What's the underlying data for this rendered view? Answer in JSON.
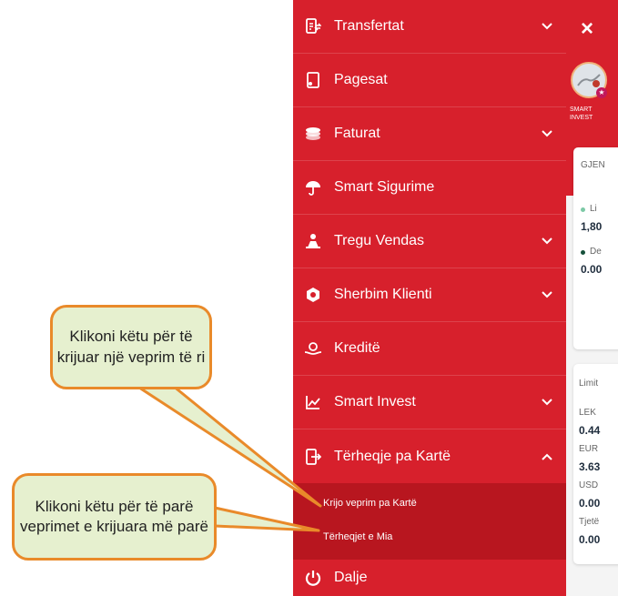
{
  "menu": {
    "items": [
      {
        "label": "Transfertat",
        "icon": "transfer-icon",
        "expandable": true
      },
      {
        "label": "Pagesat",
        "icon": "payment-icon",
        "expandable": false
      },
      {
        "label": "Faturat",
        "icon": "bills-icon",
        "expandable": true
      },
      {
        "label": "Smart Sigurime",
        "icon": "umbrella-icon",
        "expandable": false
      },
      {
        "label": "Tregu Vendas",
        "icon": "market-icon",
        "expandable": true
      },
      {
        "label": "Sherbim Klienti",
        "icon": "support-icon",
        "expandable": true
      },
      {
        "label": "Kreditë",
        "icon": "loan-icon",
        "expandable": false
      },
      {
        "label": "Smart Invest",
        "icon": "chart-icon",
        "expandable": true
      },
      {
        "label": "Tërheqje pa Kartë",
        "icon": "cardless-icon",
        "expandable": true,
        "expanded": true
      }
    ],
    "subitems": [
      "Krijo veprim pa Kartë",
      "Tërheqjet e Mia"
    ],
    "logout": "Dalje"
  },
  "panel": {
    "close": "×",
    "invest_label_1": "SMART",
    "invest_label_2": "INVEST",
    "card1_title": "GJEN",
    "card1_row1_label": "Li",
    "card1_row1_value": "1,80",
    "card1_row2_label": "De",
    "card1_row2_value": "0.00",
    "card2_title": "Limit",
    "limits": [
      {
        "label": "LEK",
        "value": "0.44"
      },
      {
        "label": "EUR",
        "value": "3.63"
      },
      {
        "label": "USD",
        "value": "0.00"
      },
      {
        "label": "Tjetë",
        "value": "0.00"
      }
    ]
  },
  "callouts": {
    "top": "Klikoni këtu për të krijuar një veprim të ri",
    "bottom": "Klikoni këtu për të parë veprimet e krijuara më parë"
  },
  "colors": {
    "menu_bg": "#d7202c",
    "submenu_bg": "#b8161f",
    "callout_fill": "#e6f0cf",
    "callout_border": "#e98a2a"
  }
}
